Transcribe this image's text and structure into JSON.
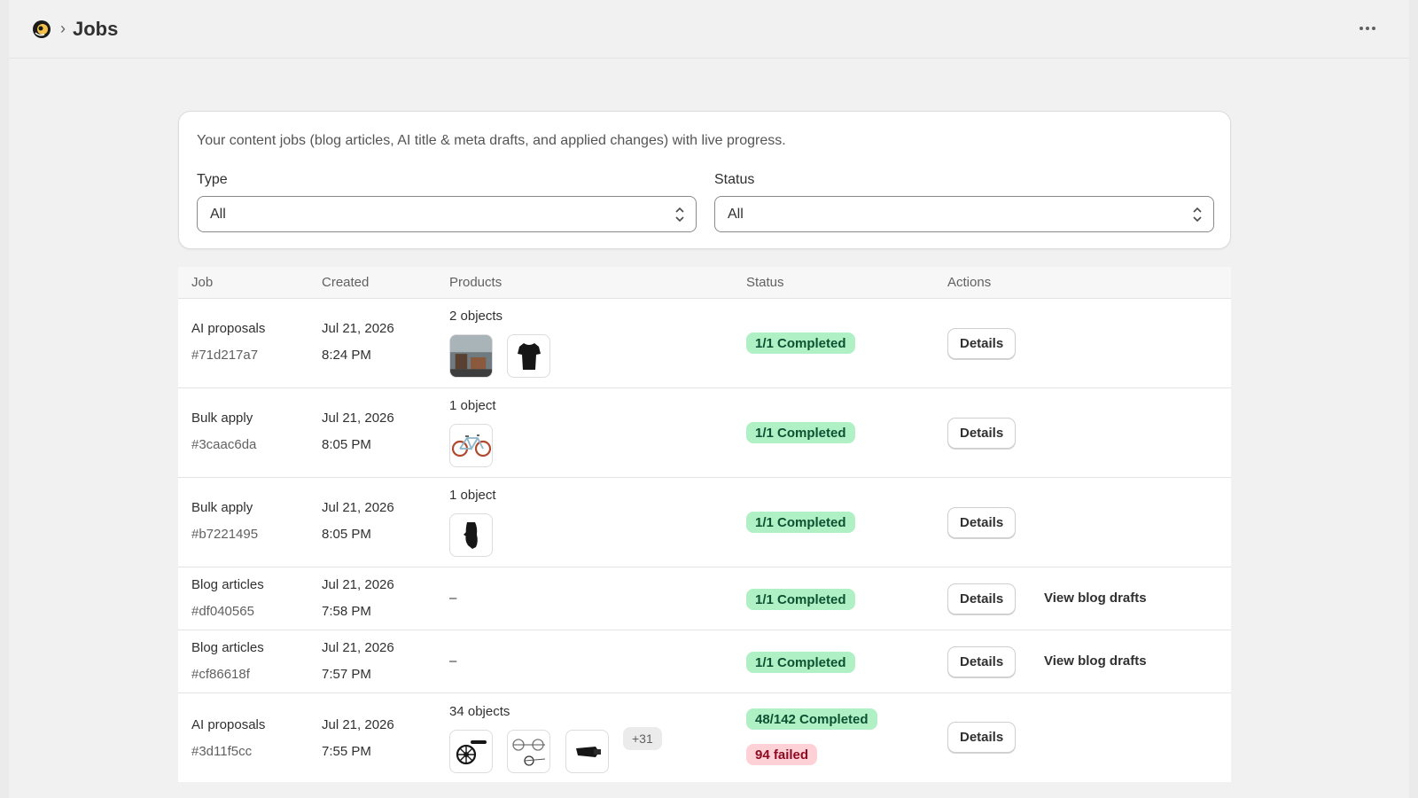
{
  "header": {
    "title": "Jobs",
    "breadcrumb_separator": "›"
  },
  "filters": {
    "description": "Your content jobs (blog articles, AI title & meta drafts, and applied changes) with live progress.",
    "type_label": "Type",
    "type_value": "All",
    "status_label": "Status",
    "status_value": "All"
  },
  "table": {
    "columns": [
      "Job",
      "Created",
      "Products",
      "Status",
      "Actions"
    ],
    "rows": [
      {
        "job": "AI proposals",
        "id": "#71d217a7",
        "date": "Jul 21, 2026",
        "time": "8:24 PM",
        "products_label": "2 objects",
        "thumbs": [
          "room-photo-icon",
          "tshirt-icon"
        ],
        "extra": "",
        "status": "1/1 Completed",
        "failed": "",
        "action": "Details",
        "link": ""
      },
      {
        "job": "Bulk apply",
        "id": "#3caac6da",
        "date": "Jul 21, 2026",
        "time": "8:05 PM",
        "products_label": "1 object",
        "thumbs": [
          "bicycle-icon"
        ],
        "extra": "",
        "status": "1/1 Completed",
        "failed": "",
        "action": "Details",
        "link": ""
      },
      {
        "job": "Bulk apply",
        "id": "#b7221495",
        "date": "Jul 21, 2026",
        "time": "8:05 PM",
        "products_label": "1 object",
        "thumbs": [
          "glove-icon"
        ],
        "extra": "",
        "status": "1/1 Completed",
        "failed": "",
        "action": "Details",
        "link": ""
      },
      {
        "job": "Blog articles",
        "id": "#df040565",
        "date": "Jul 21, 2026",
        "time": "7:58 PM",
        "products_label": "–",
        "thumbs": [],
        "extra": "",
        "status": "1/1 Completed",
        "failed": "",
        "action": "Details",
        "link": "View blog drafts"
      },
      {
        "job": "Blog articles",
        "id": "#cf86618f",
        "date": "Jul 21, 2026",
        "time": "7:57 PM",
        "products_label": "–",
        "thumbs": [],
        "extra": "",
        "status": "1/1 Completed",
        "failed": "",
        "action": "Details",
        "link": "View blog drafts"
      },
      {
        "job": "AI proposals",
        "id": "#3d11f5cc",
        "date": "Jul 21, 2026",
        "time": "7:55 PM",
        "products_label": "34 objects",
        "thumbs": [
          "crankset-icon",
          "sprocket-icon",
          "bike-part-icon"
        ],
        "extra": "+31",
        "status": "48/142 Completed",
        "failed": "94 failed",
        "action": "Details",
        "link": ""
      }
    ]
  },
  "colors": {
    "success_bg": "#aff0c4",
    "critical_bg": "#fed1d7"
  }
}
